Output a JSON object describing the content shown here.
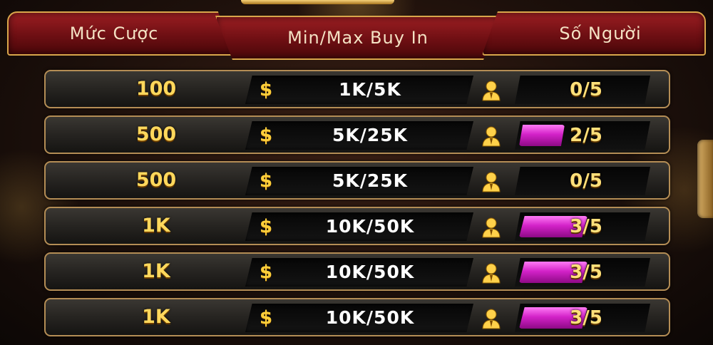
{
  "header": {
    "bet_label": "Mức Cược",
    "buyin_label": "Min/Max Buy In",
    "players_label": "Số Người"
  },
  "rows": [
    {
      "bet": "100",
      "currency": "$",
      "buyin": "1K/5K",
      "players": "0/5",
      "fill_fraction": 0.0
    },
    {
      "bet": "500",
      "currency": "$",
      "buyin": "5K/25K",
      "players": "2/5",
      "fill_fraction": 0.4
    },
    {
      "bet": "500",
      "currency": "$",
      "buyin": "5K/25K",
      "players": "0/5",
      "fill_fraction": 0.0
    },
    {
      "bet": "1K",
      "currency": "$",
      "buyin": "10K/50K",
      "players": "3/5",
      "fill_fraction": 0.6
    },
    {
      "bet": "1K",
      "currency": "$",
      "buyin": "10K/50K",
      "players": "3/5",
      "fill_fraction": 0.6
    },
    {
      "bet": "1K",
      "currency": "$",
      "buyin": "10K/50K",
      "players": "3/5",
      "fill_fraction": 0.6
    }
  ],
  "icons": {
    "player": "person-icon",
    "currency": "dollar-icon"
  },
  "colors": {
    "header_bg": "#7a1216",
    "gold": "#ffd85c",
    "fill": "#d322c8"
  }
}
